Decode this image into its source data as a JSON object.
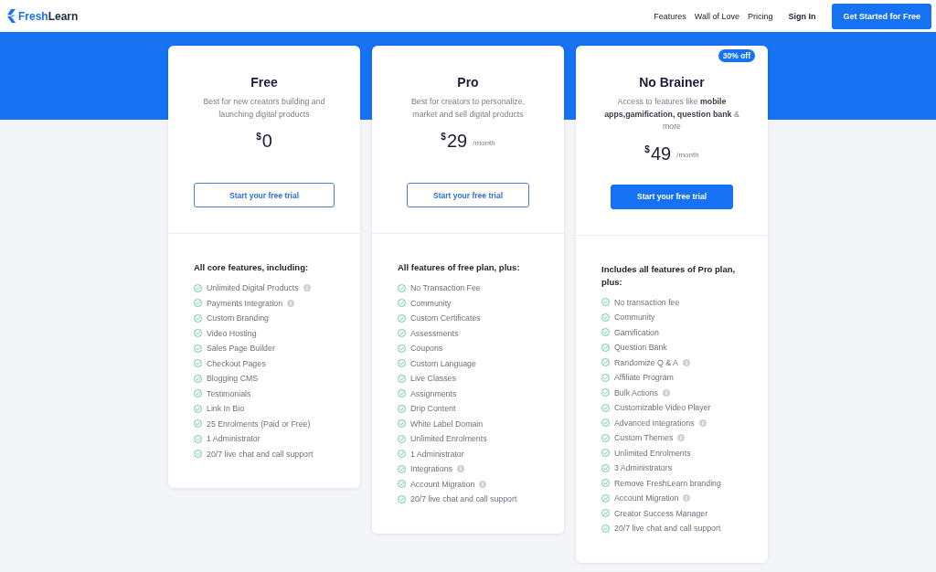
{
  "header": {
    "logo": {
      "text_primary": "Fresh",
      "text_secondary": "Learn"
    },
    "nav_links": [
      "Features",
      "Wall of Love",
      "Pricing"
    ],
    "sign_in": "Sign In",
    "cta": "Get Started for Free"
  },
  "plans": [
    {
      "name": "Free",
      "description": "Best for new creators building and launching digital products",
      "price": {
        "currency": "$",
        "amount": "0"
      },
      "button": {
        "label": "Start your free trial",
        "kind": "outline"
      },
      "features_heading": "All core features, including:",
      "features": [
        {
          "label": "Unlimited Digital Products",
          "info": true
        },
        {
          "label": "Payments Integration",
          "info": true
        },
        {
          "label": "Custom Branding",
          "info": false
        },
        {
          "label": "Video Hosting",
          "info": false
        },
        {
          "label": "Sales Page Builder",
          "info": false
        },
        {
          "label": "Checkout Pages",
          "info": false
        },
        {
          "label": "Blogging CMS",
          "info": false
        },
        {
          "label": "Testimonials",
          "info": false
        },
        {
          "label": "Link In Bio",
          "info": false
        },
        {
          "label": "25 Enrolments (Paid or Free)",
          "info": false
        },
        {
          "label": "1 Administrator",
          "info": false
        },
        {
          "label": "20/7 live chat and call support",
          "info": false
        }
      ]
    },
    {
      "name": "Pro",
      "description": "Best for creators to personalize, market and sell digital products",
      "price": {
        "currency": "$",
        "amount": "29",
        "period": "/month"
      },
      "button": {
        "label": "Start your free trial",
        "kind": "outline"
      },
      "features_heading": "All features of free plan, plus:",
      "features": [
        {
          "label": "No Transaction Fee",
          "info": false
        },
        {
          "label": "Community",
          "info": false
        },
        {
          "label": "Custom Certificates",
          "info": false
        },
        {
          "label": "Assessments",
          "info": false
        },
        {
          "label": "Coupons",
          "info": false
        },
        {
          "label": "Custom Language",
          "info": false
        },
        {
          "label": "Live Classes",
          "info": false
        },
        {
          "label": "Assignments",
          "info": false
        },
        {
          "label": "Drip Content",
          "info": false
        },
        {
          "label": "White Label Domain",
          "info": false
        },
        {
          "label": "Unlimited Enrolments",
          "info": false
        },
        {
          "label": "1 Administrator",
          "info": false
        },
        {
          "label": "Integrations",
          "info": true
        },
        {
          "label": "Account Migration",
          "info": true
        },
        {
          "label": "20/7 live chat and call support",
          "info": false
        }
      ]
    },
    {
      "name": "No Brainer",
      "badge": "30% off",
      "description": "Access to features like **mobile apps,gamification, question bank** & more",
      "price": {
        "currency": "$",
        "amount": "49",
        "period": "/month"
      },
      "button": {
        "label": "Start your free trial",
        "kind": "filled"
      },
      "features_heading": "Includes all features of Pro plan, plus:",
      "features": [
        {
          "label": "No transaction fee",
          "info": false
        },
        {
          "label": "Community",
          "info": false
        },
        {
          "label": "Gamification",
          "info": false
        },
        {
          "label": "Question Bank",
          "info": false
        },
        {
          "label": "Randomize Q & A",
          "info": true
        },
        {
          "label": "Affiliate Program",
          "info": false
        },
        {
          "label": "Bulk Actions",
          "info": true
        },
        {
          "label": "Customizable Video Player",
          "info": false
        },
        {
          "label": "Advanced Integrations",
          "info": true
        },
        {
          "label": "Custom Themes",
          "info": true
        },
        {
          "label": "Unlimited Enrolments",
          "info": false
        },
        {
          "label": "3 Administrators",
          "info": false
        },
        {
          "label": "Remove FreshLearn branding",
          "info": false
        },
        {
          "label": "Account Migration",
          "info": true
        },
        {
          "label": "Creator Success Manager",
          "info": false
        },
        {
          "label": "20/7 live chat and call support",
          "info": false
        }
      ]
    }
  ]
}
